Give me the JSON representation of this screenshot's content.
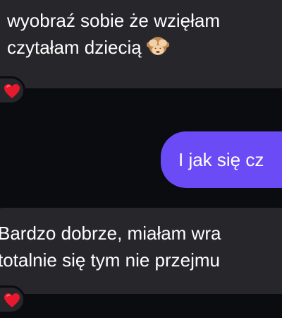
{
  "messages": [
    {
      "direction": "incoming",
      "lines": [
        "wyobraź sobie że wzięłam",
        "czytałam dziecią"
      ],
      "emoji": "see-no-evil-monkey",
      "reaction": "red-heart"
    },
    {
      "direction": "outgoing",
      "text": "I jak się cz"
    },
    {
      "direction": "incoming",
      "lines": [
        "Bardzo dobrze, miałam wra",
        "totalnie się tym nie przejmu"
      ],
      "reaction": "red-heart"
    }
  ],
  "colors": {
    "background": "#0b0c0f",
    "incoming_bubble": "#26262b",
    "outgoing_bubble": "#6a4bf5",
    "text": "#ffffff",
    "heart": "#e8192c"
  },
  "icons": {
    "reaction": "heart-icon",
    "emoji": "see-no-evil-monkey-icon"
  }
}
